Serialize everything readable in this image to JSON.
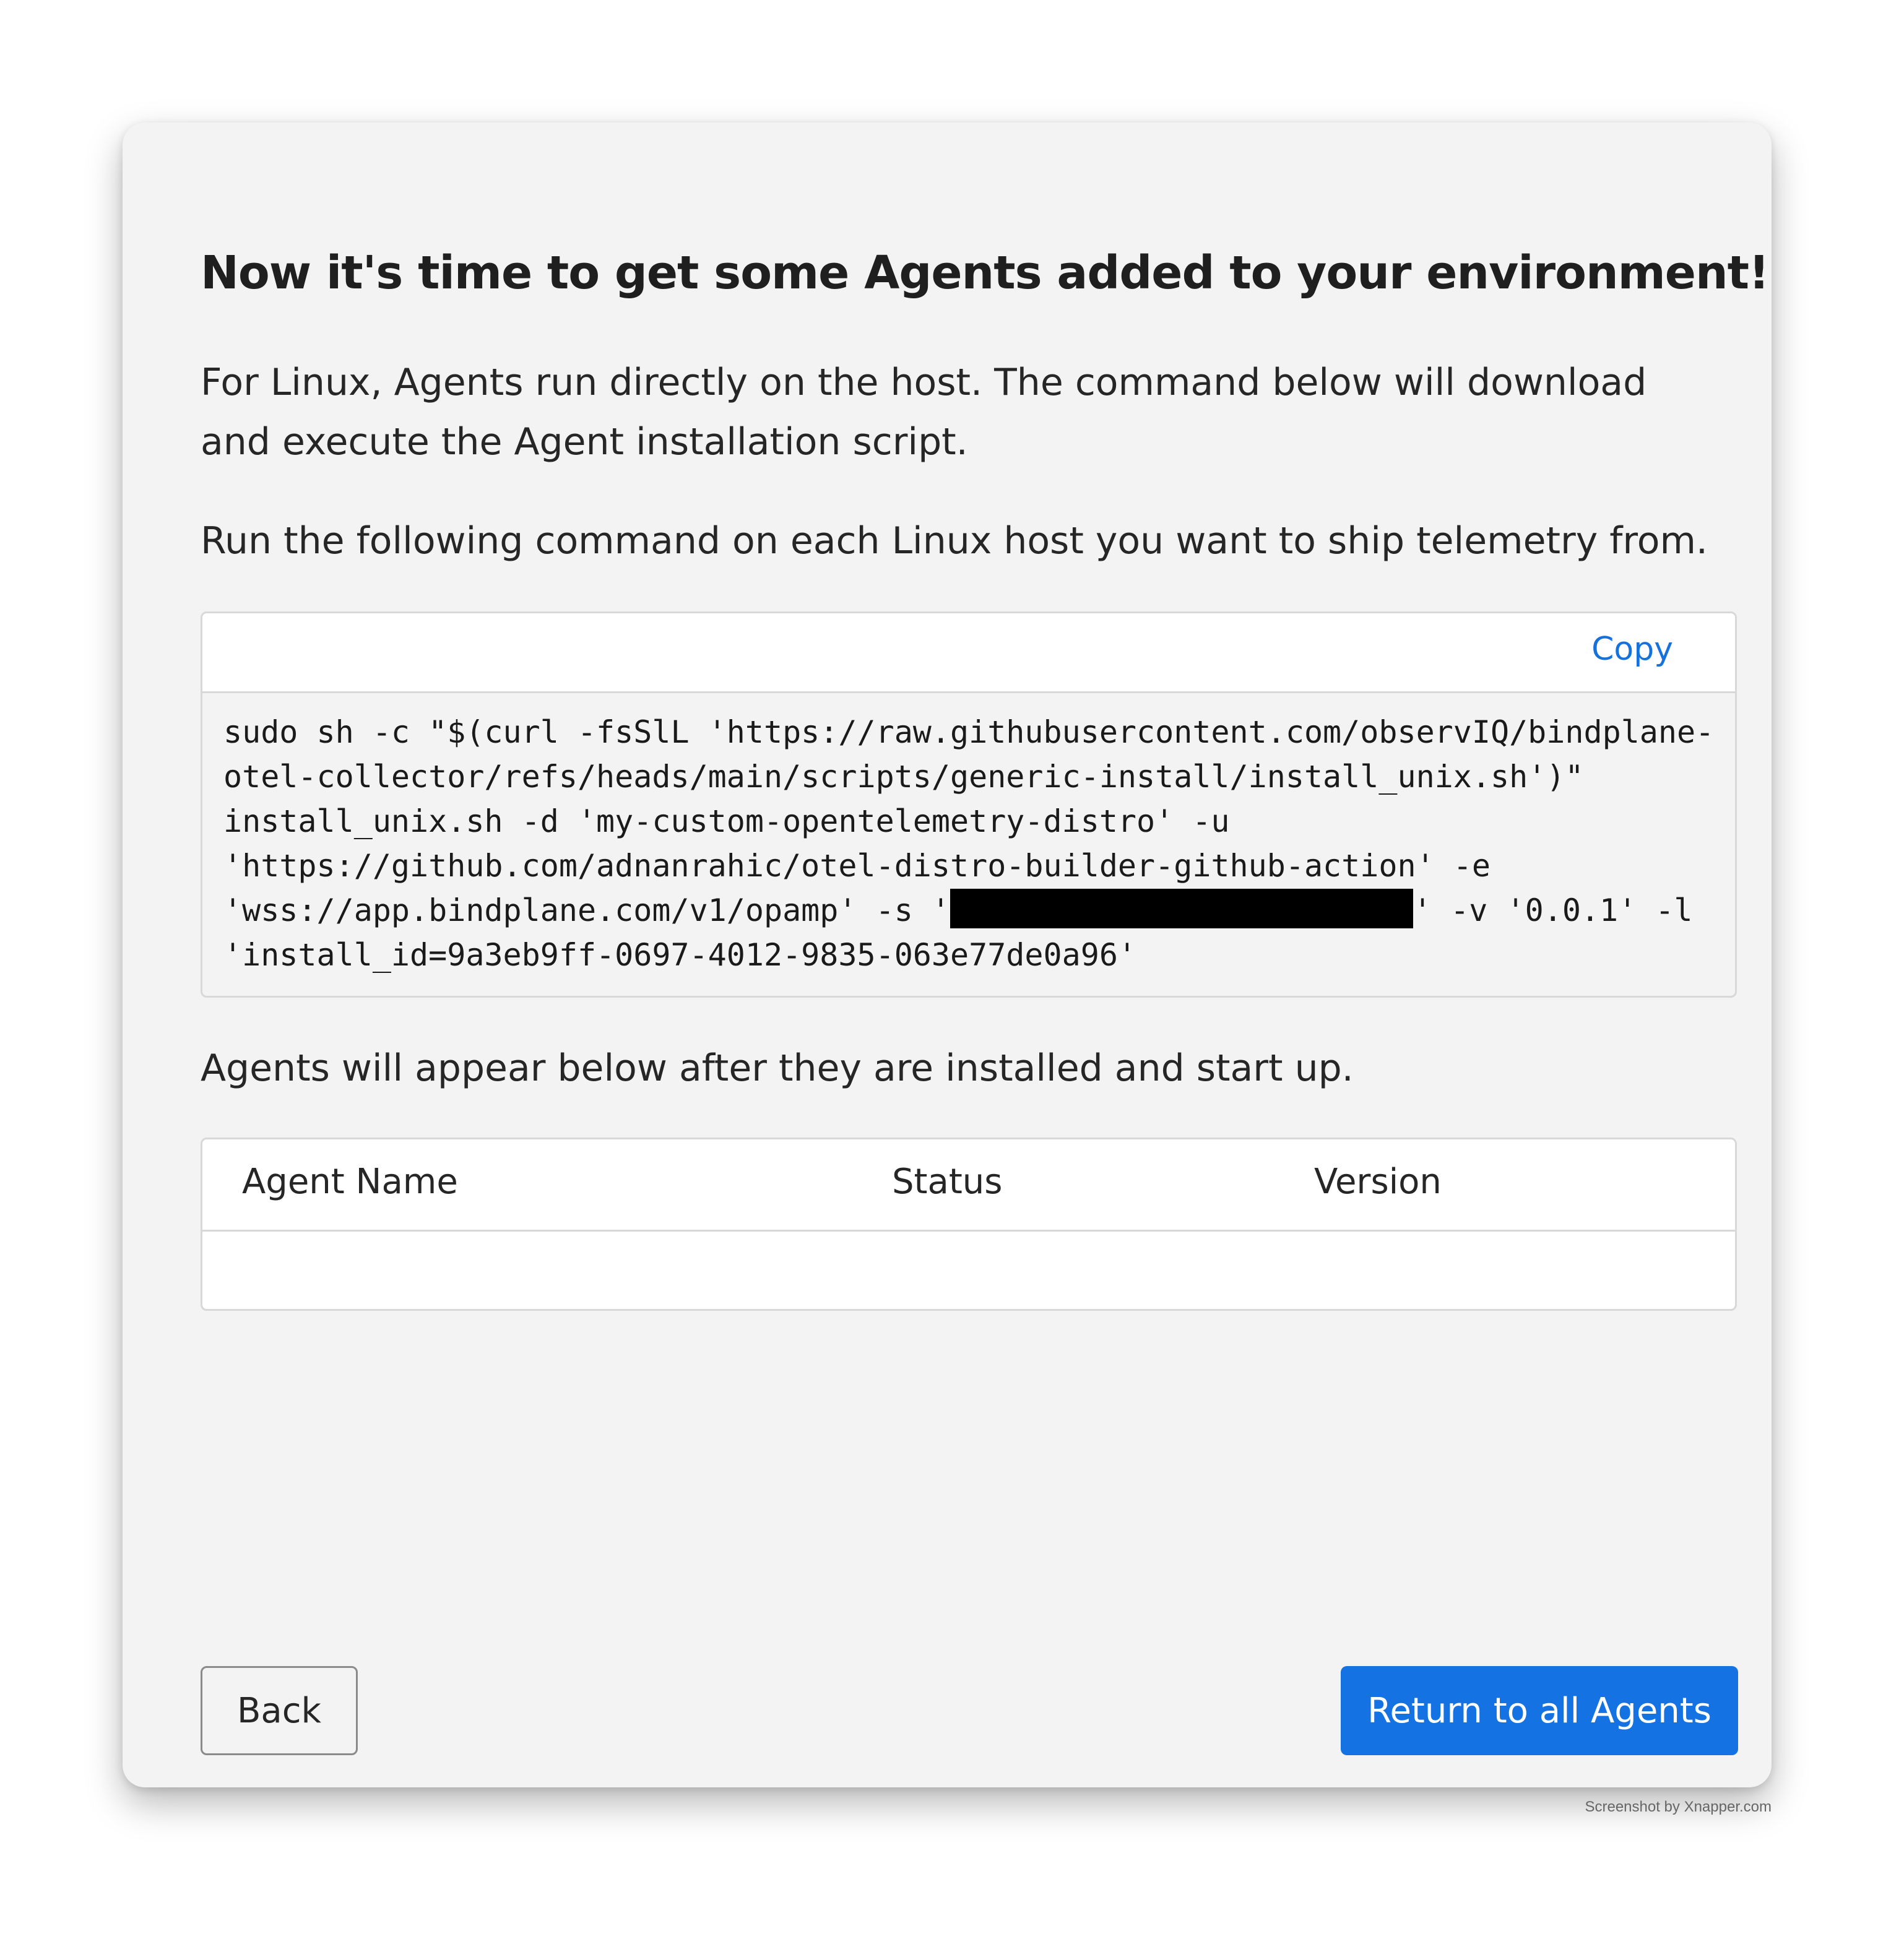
{
  "heading": "Now it's time to get some Agents added to your environment!",
  "intro": "For Linux, Agents run directly on the host. The command below will download and execute the Agent installation script.",
  "instruction": "Run the following command on each Linux host you want to ship telemetry from.",
  "command_box": {
    "copy_label": "Copy",
    "line1": "sudo sh -c \"$(curl -fsSlL 'https://raw.githubusercontent.com/observIQ/bindplane-",
    "line2": "otel-collector/refs/heads/main/scripts/generic-install/install_unix.sh')\"",
    "line3": "install_unix.sh -d 'my-custom-opentelemetry-distro' -u",
    "line4": "'https://github.com/adnanrahic/otel-distro-builder-github-action' -e",
    "line5_start": "'wss://app.bindplane.com/v1/opamp' -s '",
    "line5_end": "' -v '0.0.1' -l",
    "line6": "'install_id=9a3eb9ff-0697-4012-9835-063e77de0a96'"
  },
  "agents_note": "Agents will appear below after they are installed and start up.",
  "agents_table": {
    "columns": [
      "Agent Name",
      "Status",
      "Version"
    ],
    "rows": []
  },
  "buttons": {
    "back": "Back",
    "return": "Return to all Agents"
  },
  "watermark": "Screenshot by Xnapper.com",
  "colors": {
    "primary": "#1572e3",
    "link": "#1572dc",
    "panel_bg": "#f3f3f3"
  }
}
